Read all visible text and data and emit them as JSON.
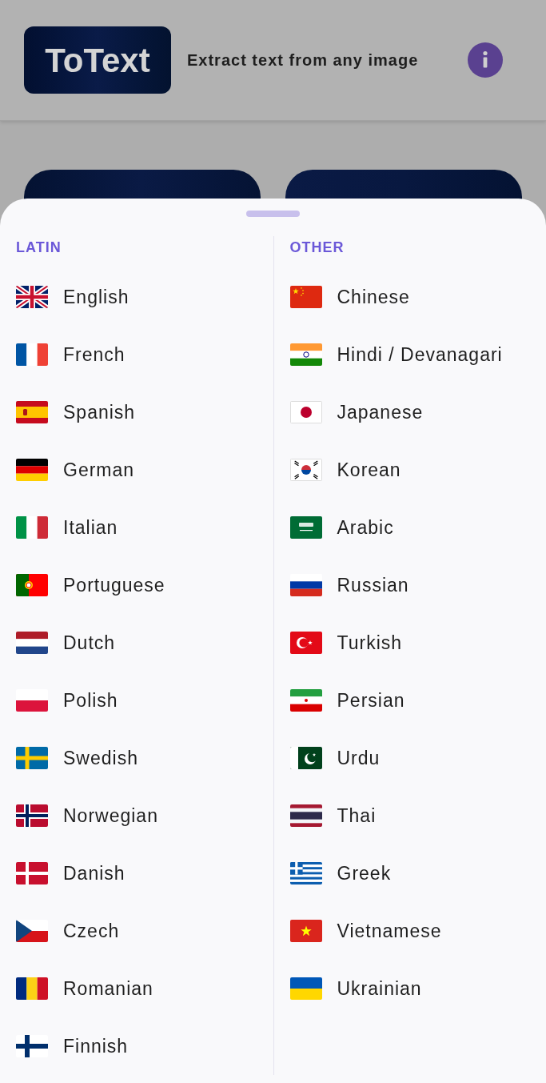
{
  "header": {
    "logo": "ToText",
    "tagline": "Extract text from any image"
  },
  "sheet": {
    "columns": [
      {
        "heading": "LATIN",
        "languages": [
          "English",
          "French",
          "Spanish",
          "German",
          "Italian",
          "Portuguese",
          "Dutch",
          "Polish",
          "Swedish",
          "Norwegian",
          "Danish",
          "Czech",
          "Romanian",
          "Finnish"
        ]
      },
      {
        "heading": "OTHER",
        "languages": [
          "Chinese",
          "Hindi / Devanagari",
          "Japanese",
          "Korean",
          "Arabic",
          "Russian",
          "Turkish",
          "Persian",
          "Urdu",
          "Thai",
          "Greek",
          "Vietnamese",
          "Ukrainian"
        ]
      }
    ]
  }
}
